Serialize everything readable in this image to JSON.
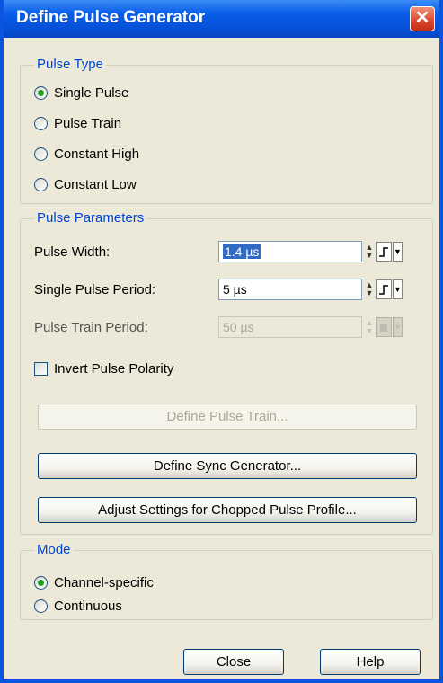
{
  "window": {
    "title": "Define Pulse Generator",
    "close_glyph": "✕"
  },
  "pulse_type": {
    "legend": "Pulse Type",
    "options": [
      {
        "label": "Single Pulse",
        "selected": true
      },
      {
        "label": "Pulse Train",
        "selected": false
      },
      {
        "label": "Constant High",
        "selected": false
      },
      {
        "label": "Constant Low",
        "selected": false
      }
    ]
  },
  "pulse_parameters": {
    "legend": "Pulse Parameters",
    "pulse_width": {
      "label": "Pulse Width:",
      "value": "1.4 µs"
    },
    "single_pulse_period": {
      "label": "Single Pulse Period:",
      "value": "5 µs"
    },
    "pulse_train_period": {
      "label": "Pulse Train Period:",
      "value": "50 µs",
      "enabled": false
    },
    "invert_polarity": {
      "label": "Invert Pulse Polarity",
      "checked": false
    },
    "buttons": {
      "define_pulse_train": "Define Pulse Train...",
      "define_sync_generator": "Define Sync Generator...",
      "adjust_settings": "Adjust Settings for Chopped Pulse Profile..."
    }
  },
  "mode": {
    "legend": "Mode",
    "options": [
      {
        "label": "Channel-specific",
        "selected": true
      },
      {
        "label": "Continuous",
        "selected": false
      }
    ]
  },
  "footer": {
    "close_label": "Close",
    "help_label": "Help"
  },
  "glyphs": {
    "spin_up": "▲",
    "spin_down": "▼",
    "dropdown": "▼"
  }
}
